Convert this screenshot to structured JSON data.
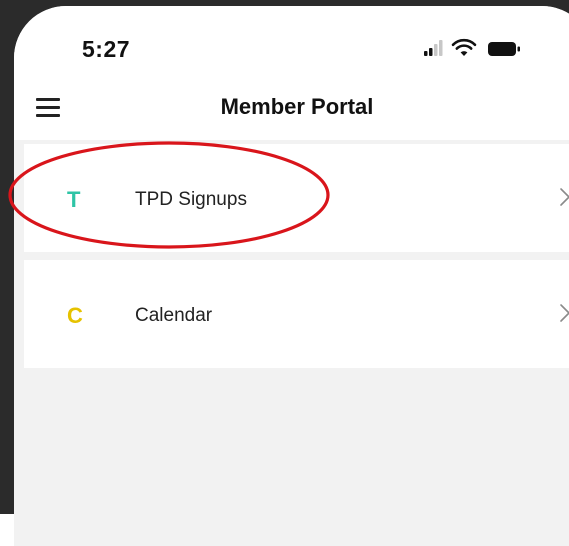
{
  "status_bar": {
    "time": "5:27",
    "icons": [
      "cellular-signal-icon",
      "wifi-icon",
      "battery-icon"
    ]
  },
  "nav": {
    "menu_icon": "hamburger-menu-icon",
    "title": "Member Portal"
  },
  "menu_items": [
    {
      "letter": "T",
      "letter_color": "#2ec4a6",
      "label": "TPD Signups",
      "chevron": "chevron-right-icon"
    },
    {
      "letter": "C",
      "letter_color": "#e6c200",
      "label": "Calendar",
      "chevron": "chevron-right-icon"
    }
  ],
  "annotation": {
    "shape": "ellipse",
    "color": "#d9151b",
    "target": "TPD Signups"
  },
  "colors": {
    "bezel": "#2b2b2b",
    "screen_bg": "#f2f2f2",
    "card_bg": "#ffffff"
  }
}
